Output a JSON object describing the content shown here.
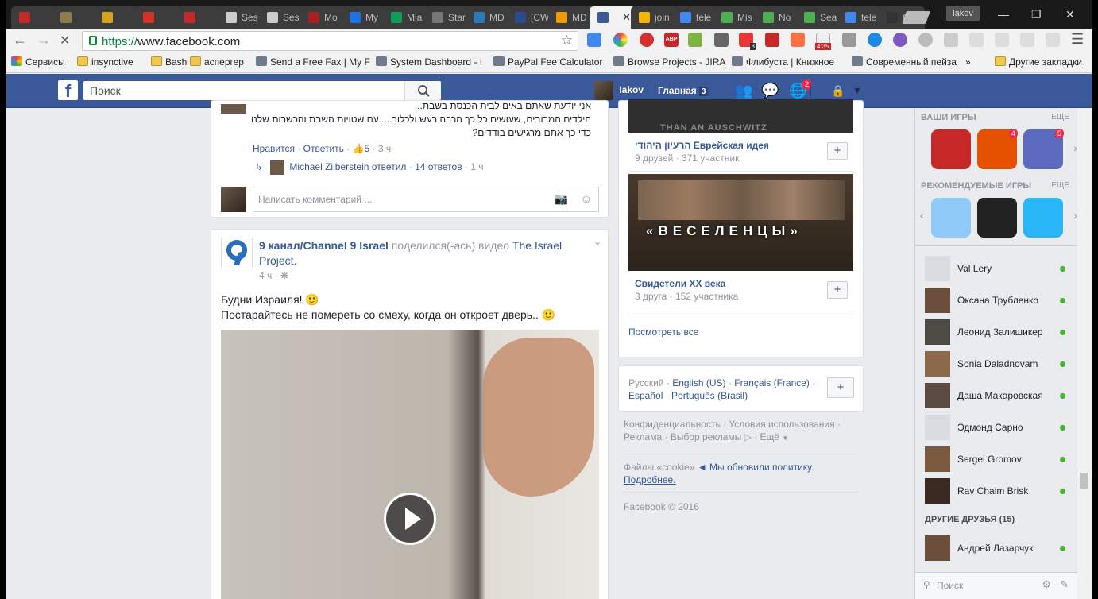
{
  "browser": {
    "tabs": [
      {
        "label": "",
        "color": "#c62828"
      },
      {
        "label": "",
        "color": "#8d7b4a"
      },
      {
        "label": "",
        "color": "#d6a21a"
      },
      {
        "label": "",
        "color": "#d93025"
      },
      {
        "label": "",
        "color": "#c62828"
      },
      {
        "label": "Ses",
        "color": "#cccccc"
      },
      {
        "label": "Ses",
        "color": "#cccccc"
      },
      {
        "label": "Mo",
        "color": "#a62020"
      },
      {
        "label": "My",
        "color": "#1a73e8"
      },
      {
        "label": "Mia",
        "color": "#0f9d58"
      },
      {
        "label": "Star",
        "color": "#777777"
      },
      {
        "label": "MD",
        "color": "#2a7ab8"
      },
      {
        "label": "[CW",
        "color": "#2a4b8d"
      },
      {
        "label": "MD",
        "color": "#f29900"
      },
      {
        "label": "",
        "color": "#3b5998"
      },
      {
        "label": "join",
        "color": "#f4b400"
      },
      {
        "label": "tele",
        "color": "#4285f4"
      },
      {
        "label": "Mis",
        "color": "#4caf50"
      },
      {
        "label": "No",
        "color": "#4caf50"
      },
      {
        "label": "Sea",
        "color": "#4caf50"
      },
      {
        "label": "tele",
        "color": "#4285f4"
      },
      {
        "label": "Clo",
        "color": "#333333"
      }
    ],
    "active_tab_index": 14,
    "profile_name": "lakov",
    "url_protocol": "https://",
    "url_host": "www.facebook.com",
    "extension_badge_count": "3",
    "extension_timer": "4:35",
    "bookmarks": [
      {
        "label": "Сервисы",
        "type": "apps"
      },
      {
        "label": "insynctive",
        "type": "folder"
      },
      {
        "label": "Bash",
        "type": "folder"
      },
      {
        "label": "аспергер",
        "type": "folder"
      },
      {
        "label": "Send a Free Fax | My F",
        "type": "site"
      },
      {
        "label": "System Dashboard - I",
        "type": "site"
      },
      {
        "label": "PayPal Fee Calculator",
        "type": "site"
      },
      {
        "label": "Browse Projects - JIRA",
        "type": "site"
      },
      {
        "label": "Флибуста | Книжное",
        "type": "site"
      },
      {
        "label": "Современный пейза",
        "type": "site"
      }
    ],
    "bookmarks_more": "»",
    "other_bookmarks": "Другие закладки"
  },
  "fb": {
    "search_placeholder": "Поиск",
    "user_name": "Iakov",
    "home_label": "Главная",
    "home_count": "3",
    "notif_count": "2"
  },
  "comment": {
    "text_line1": "אני יודעת שאתם באים לבית הכנסת בשבת...",
    "text_line2": "הילדים המרובים, שעושים כל כך הרבה רעש ולכלוך.... עם שטויות השבת והכשרות שלנו... עד",
    "text_line3": "כדי כך אתם מרגישים בודדים?",
    "like": "Нравится",
    "reply": "Ответить",
    "likes_count": "5",
    "time": "3 ч",
    "reply_author": "Michael Zilberstein ответил",
    "reply_count": "14 ответов",
    "reply_time": "1 ч",
    "input_placeholder": "Написать комментарий ..."
  },
  "post": {
    "page_name": "9 канал/Channel 9 Israel",
    "action": "поделился(-ась) видео",
    "shared_page": "The Israel Project.",
    "time": "4 ч",
    "text_line1": "Будни Израиля! 🙂",
    "text_line2": "Постарайтесь не помереть со смеху, когда он откроет дверь.. 🙂"
  },
  "groups": [
    {
      "banner_text": "THAN AN AUSCHWITZ",
      "name": "הרעיון היהודי Еврейская идея",
      "meta": "9 друзей · 371 участник"
    },
    {
      "banner_text": "«ВЕСЕЛЕНЦЫ»",
      "name": "Свидетели XX века",
      "meta": "3 друга · 152 участника"
    }
  ],
  "see_all": "Посмотреть все",
  "languages": {
    "current": "Русский",
    "options_line1": [
      "English (US)",
      "Français (France)"
    ],
    "options_line2": [
      "Español",
      "Português (Brasil)"
    ]
  },
  "footer": {
    "line1": [
      "Конфиденциальность",
      "Условия использования"
    ],
    "line2": [
      "Реклама",
      "Выбор рекламы",
      "Ещё"
    ],
    "cookie_text": "Файлы «cookie»",
    "cookie_link": "◄ Мы обновили политику.",
    "more_link": "Подробнее.",
    "copyright": "Facebook © 2016"
  },
  "games": {
    "your_games_title": "ВАШИ ИГРЫ",
    "more": "ЕЩЕ",
    "your_games": [
      {
        "name": "game-shield",
        "badge": "",
        "color": "#c62828"
      },
      {
        "name": "game-candy",
        "badge": "4",
        "color": "#e65100"
      },
      {
        "name": "game-fashion",
        "badge": "5",
        "color": "#5c6bc0"
      }
    ],
    "recommended_title": "РЕКОМЕНДУЕМЫЕ ИГРЫ",
    "recommended": [
      {
        "name": "game-hangman",
        "color": "#90caf9"
      },
      {
        "name": "game-snake",
        "color": "#212121"
      },
      {
        "name": "game-cube",
        "color": "#29b6f6"
      }
    ]
  },
  "chat": {
    "contacts": [
      "Val Lery",
      "Оксана Трубленко",
      "Леонид Залишикер",
      "Sonia Daladnovam",
      "Даша Макаровская",
      "Эдмонд Сарно",
      "Sergei Gromov",
      "Rav Chaim Brisk"
    ],
    "other_friends_title": "ДРУГИЕ ДРУЗЬЯ (15)",
    "other_contacts": [
      "Андрей Лазарчук"
    ],
    "search_placeholder": "Поиск"
  }
}
